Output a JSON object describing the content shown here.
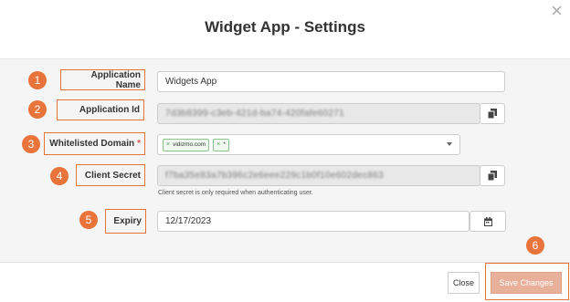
{
  "dialog": {
    "title": "Widget App - Settings",
    "close_glyph": "×"
  },
  "fields": {
    "app_name": {
      "number": "1",
      "label": "Application Name",
      "value": "Widgets App"
    },
    "app_id": {
      "number": "2",
      "label": "Application Id",
      "value": "7d3b8399-c3eb-421d-ba74-420fafe60271",
      "copy_icon": "copy-icon"
    },
    "domain": {
      "number": "3",
      "label": "Whitelisted Domain",
      "required": "*",
      "tags": [
        "vidizmo.com",
        "*"
      ],
      "tag_remove": "×"
    },
    "secret": {
      "number": "4",
      "label": "Client Secret",
      "value": "f7ba35e83a7b396c2e6eee229c1b0f10e602dec863",
      "helper": "Client secret is only required when authenticating user.",
      "copy_icon": "copy-icon"
    },
    "expiry": {
      "number": "5",
      "label": "Expiry",
      "value": "12/17/2023",
      "calendar_icon": "calendar-icon"
    }
  },
  "footer": {
    "close_label": "Close",
    "save_number": "6",
    "save_label": "Save Changes"
  },
  "colors": {
    "accent": "#e8743b",
    "save_bg": "#e8b09a"
  }
}
